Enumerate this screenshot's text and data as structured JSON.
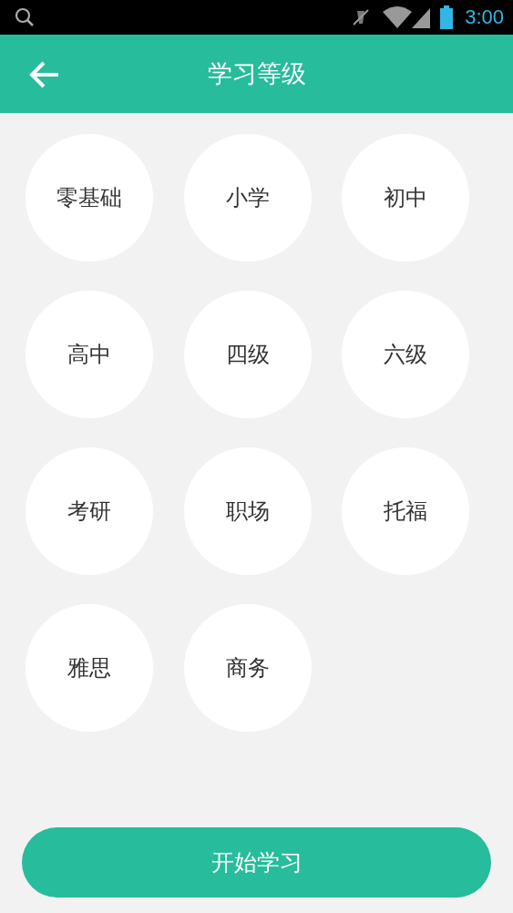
{
  "status_bar": {
    "time": "3:00"
  },
  "header": {
    "title": "学习等级"
  },
  "levels": [
    {
      "label": "零基础"
    },
    {
      "label": "小学"
    },
    {
      "label": "初中"
    },
    {
      "label": "高中"
    },
    {
      "label": "四级"
    },
    {
      "label": "六级"
    },
    {
      "label": "考研"
    },
    {
      "label": "职场"
    },
    {
      "label": "托福"
    },
    {
      "label": "雅思"
    },
    {
      "label": "商务"
    }
  ],
  "start_button": {
    "label": "开始学习"
  }
}
